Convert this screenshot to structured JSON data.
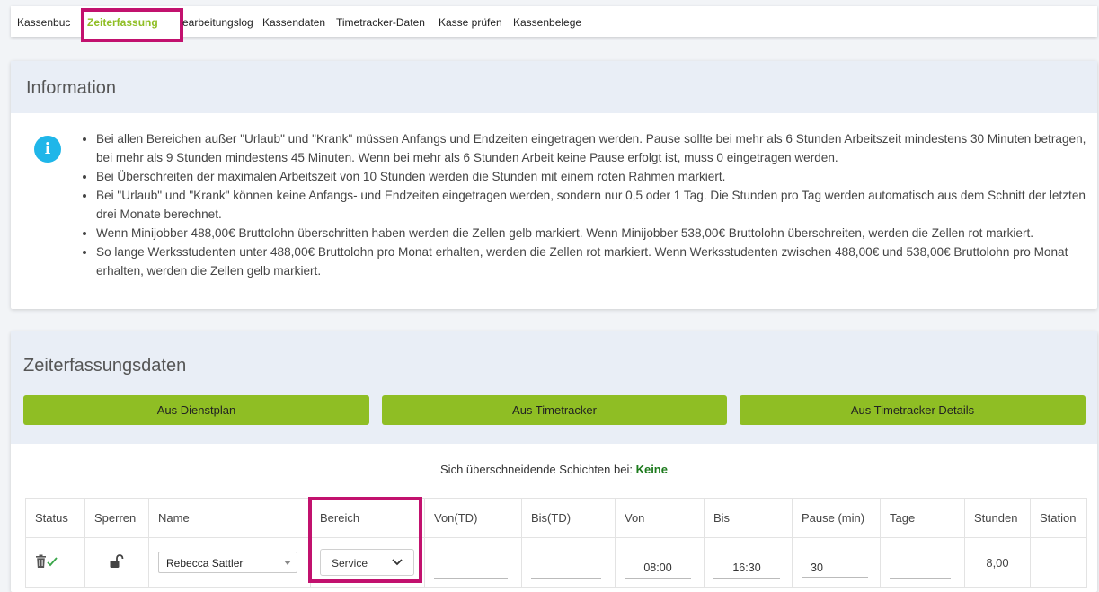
{
  "nav": {
    "tabs": [
      "Kassenbuc",
      "Zeiterfassung",
      "earbeitungslog",
      "Kassendaten",
      "Timetracker-Daten",
      "Kasse prüfen",
      "Kassenbelege"
    ],
    "active": "Zeiterfassung"
  },
  "info": {
    "title": "Information",
    "icon": "info-icon",
    "items": [
      "Bei allen Bereichen außer \"Urlaub\" und \"Krank\" müssen Anfangs und Endzeiten eingetragen werden. Pause sollte bei mehr als 6 Stunden Arbeitszeit mindestens 30 Minuten betragen, bei mehr als 9 Stunden mindestens 45 Minuten. Wenn bei mehr als 6 Stunden Arbeit keine Pause erfolgt ist, muss 0 eingetragen werden.",
      "Bei Überschreiten der maximalen Arbeitszeit von 10 Stunden werden die Stunden mit einem roten Rahmen markiert.",
      "Bei \"Urlaub\" und \"Krank\" können keine Anfangs- und Endzeiten eingetragen werden, sondern nur 0,5 oder 1 Tag. Die Stunden pro Tag werden automatisch aus dem Schnitt der letzten drei Monate berechnet.",
      "Wenn Minijobber 488,00€ Bruttolohn überschritten haben werden die Zellen gelb markiert. Wenn Minijobber 538,00€ Bruttolohn überschreiten, werden die Zellen rot markiert.",
      "So lange Werksstudenten unter 488,00€ Bruttolohn pro Monat erhalten, werden die Zellen rot markiert. Wenn Werksstudenten zwischen 488,00€ und 538,00€ Bruttolohn pro Monat erhalten, werden die Zellen gelb markiert."
    ]
  },
  "zeit": {
    "title": "Zeiterfassungsdaten",
    "buttons": [
      "Aus Dienstplan",
      "Aus Timetracker",
      "Aus Timetracker Details"
    ],
    "overlap_label": "Sich überschneidende Schichten bei:",
    "overlap_value": "Keine",
    "table": {
      "headers": [
        "Status",
        "Sperren",
        "Name",
        "Bereich",
        "Von(TD)",
        "Bis(TD)",
        "Von",
        "Bis",
        "Pause (min)",
        "Tage",
        "Stunden",
        "Station"
      ],
      "row": {
        "name": "Rebecca Sattler",
        "bereich": "Service",
        "von_td": "",
        "bis_td": "",
        "von": "08:00",
        "bis": "16:30",
        "pause": "30",
        "tage": "",
        "stunden": "8,00",
        "station": ""
      }
    }
  },
  "colors": {
    "accent": "#8fbe24",
    "highlight": "#c2116e",
    "info_icon": "#1fb6e9",
    "ok_text": "#1d7a1d"
  }
}
